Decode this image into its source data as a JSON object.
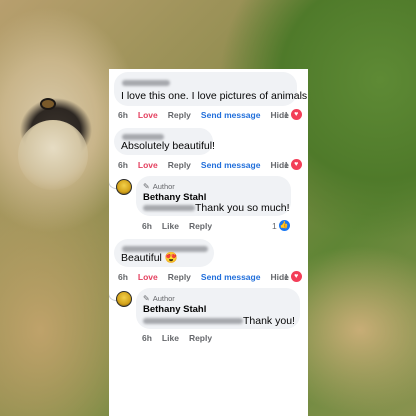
{
  "comments": [
    {
      "text": "I love this one. I love pictures of animals",
      "time": "6h",
      "actions": [
        "Love",
        "Reply",
        "Send message",
        "Hide"
      ],
      "reaction_count": "1",
      "reaction_icon": "heart-icon"
    },
    {
      "text": "Absolutely beautiful!",
      "time": "6h",
      "actions": [
        "Love",
        "Reply",
        "Send message",
        "Hide"
      ],
      "reaction_count": "1",
      "reaction_icon": "heart-icon",
      "reply": {
        "author_badge": "Author",
        "name": "Bethany Stahl",
        "text": "Thank you so much!",
        "time": "6h",
        "actions": [
          "Like",
          "Reply"
        ],
        "reaction_count": "1",
        "reaction_icon": "like-icon"
      }
    },
    {
      "text": "Beautiful 😍",
      "time": "6h",
      "actions": [
        "Love",
        "Reply",
        "Send message",
        "Hide"
      ],
      "reaction_count": "1",
      "reaction_icon": "heart-icon",
      "reply": {
        "author_badge": "Author",
        "name": "Bethany Stahl",
        "text": "Thank you!",
        "time": "6h",
        "actions": [
          "Like",
          "Reply"
        ]
      }
    }
  ],
  "colors": {
    "love": "#e4405f",
    "send_message": "#216fdb",
    "heart_badge": "#f33e58",
    "like_badge": "#1877f2",
    "bubble": "#f0f2f5"
  }
}
